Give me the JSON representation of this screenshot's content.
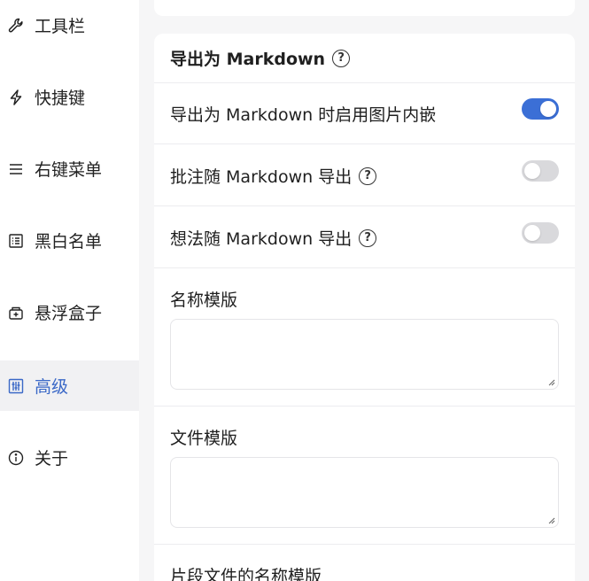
{
  "sidebar": {
    "items": [
      {
        "label": "工具栏",
        "icon": "wrench-icon"
      },
      {
        "label": "快捷键",
        "icon": "lightning-icon"
      },
      {
        "label": "右键菜单",
        "icon": "menu-lines-icon"
      },
      {
        "label": "黑白名单",
        "icon": "list-icon"
      },
      {
        "label": "悬浮盒子",
        "icon": "floating-box-icon"
      },
      {
        "label": "高级",
        "icon": "sliders-icon",
        "active": true
      },
      {
        "label": "关于",
        "icon": "info-icon"
      }
    ]
  },
  "section": {
    "title": "导出为 Markdown",
    "help": "?",
    "settings": [
      {
        "label": "导出为 Markdown 时启用图片内嵌",
        "enabled": true
      },
      {
        "label": "批注随 Markdown 导出",
        "enabled": false,
        "help": "?"
      },
      {
        "label": "想法随 Markdown 导出",
        "enabled": false,
        "help": "?"
      }
    ],
    "fields": [
      {
        "label": "名称模版",
        "value": ""
      },
      {
        "label": "文件模版",
        "value": ""
      },
      {
        "label": "片段文件的名称模版"
      }
    ]
  },
  "colors": {
    "accent": "#3b6fd6",
    "active_bg": "#f1f1f3",
    "toggle_off": "#d9d9dc"
  }
}
